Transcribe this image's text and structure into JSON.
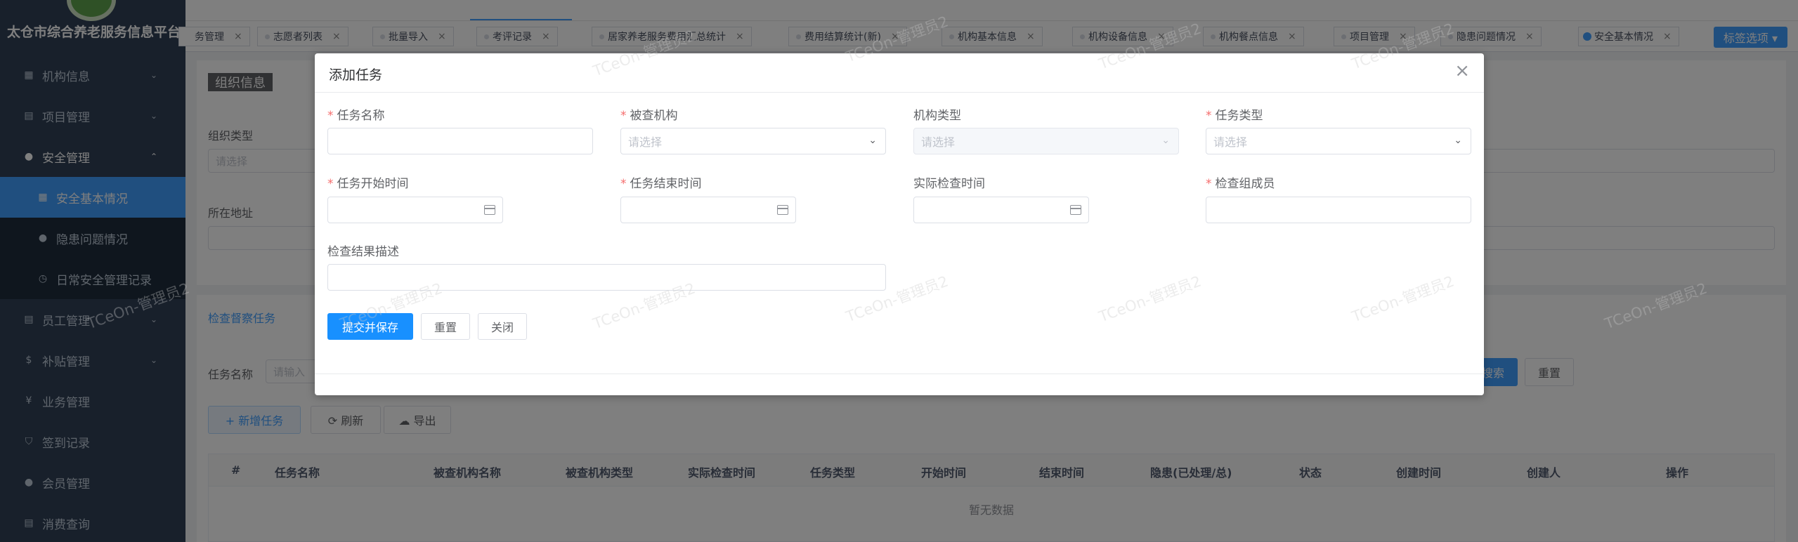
{
  "app": {
    "brand": "太仓市综合养老服务信息平台"
  },
  "sidebar": {
    "items": [
      {
        "label": "机构信息",
        "icon": "grid-icon",
        "chevron": "⌄"
      },
      {
        "label": "项目管理",
        "icon": "doc-icon",
        "chevron": "⌄"
      },
      {
        "label": "安全管理",
        "icon": "pin-icon",
        "chevron": "⌃"
      },
      {
        "label": "安全基本情况",
        "icon": "grid-icon"
      },
      {
        "label": "隐患问题情况",
        "icon": "alert-icon"
      },
      {
        "label": "日常安全管理记录",
        "icon": "clock-icon"
      },
      {
        "label": "员工管理",
        "icon": "doc-icon",
        "chevron": "⌄"
      },
      {
        "label": "补贴管理",
        "icon": "dollar-icon",
        "chevron": "⌄"
      },
      {
        "label": "业务管理",
        "icon": "yen-icon"
      },
      {
        "label": "签到记录",
        "icon": "shield-icon"
      },
      {
        "label": "会员管理",
        "icon": "user-icon"
      },
      {
        "label": "消费查询",
        "icon": "doc-icon"
      }
    ]
  },
  "tags": {
    "items": [
      "务管理",
      "志愿者列表",
      "批量导入",
      "考评记录",
      "居家养老服务费用汇总统计",
      "费用结算统计(新)",
      "机构基本信息",
      "机构设备信息",
      "机构餐点信息",
      "项目管理",
      "隐患问题情况",
      "安全基本情况"
    ],
    "option_label": "标签选项 ▾"
  },
  "background": {
    "section_title": "组织信息",
    "org_type_label": "组织类型",
    "org_type_placeholder": "请选择",
    "address_label": "所在地址",
    "tab_label": "检查督察任务",
    "task_name_label": "任务名称",
    "task_name_placeholder": "请输入",
    "search_label": "搜索",
    "reset_label": "重置",
    "add_label": "+ 新增任务",
    "refresh_label": "⟳ 刷新",
    "export_label": "☁ 导出",
    "columns": [
      "#",
      "任务名称",
      "被查机构名称",
      "被查机构类型",
      "实际检查时间",
      "任务类型",
      "开始时间",
      "结束时间",
      "隐患(已处理/总)",
      "状态",
      "创建时间",
      "创建人",
      "操作"
    ],
    "empty_text": "暂无数据"
  },
  "dialog": {
    "title": "添加任务",
    "close_glyph": "×",
    "required_mark": "*",
    "fields": {
      "task_name": {
        "label": "任务名称",
        "value": ""
      },
      "inspected_org": {
        "label": "被查机构",
        "placeholder": "请选择"
      },
      "org_type": {
        "label": "机构类型",
        "placeholder": "请选择"
      },
      "task_type": {
        "label": "任务类型",
        "placeholder": "请选择"
      },
      "start_time": {
        "label": "任务开始时间"
      },
      "end_time": {
        "label": "任务结束时间"
      },
      "actual_time": {
        "label": "实际检查时间"
      },
      "members": {
        "label": "检查组成员"
      },
      "result_desc": {
        "label": "检查结果描述"
      }
    },
    "buttons": {
      "submit": "提交并保存",
      "reset": "重置",
      "close": "关闭"
    }
  },
  "watermark": "TCeOn-管理员2",
  "colors": {
    "primary": "#409eff",
    "sidebar": "#304156",
    "required": "#f56c6c"
  }
}
